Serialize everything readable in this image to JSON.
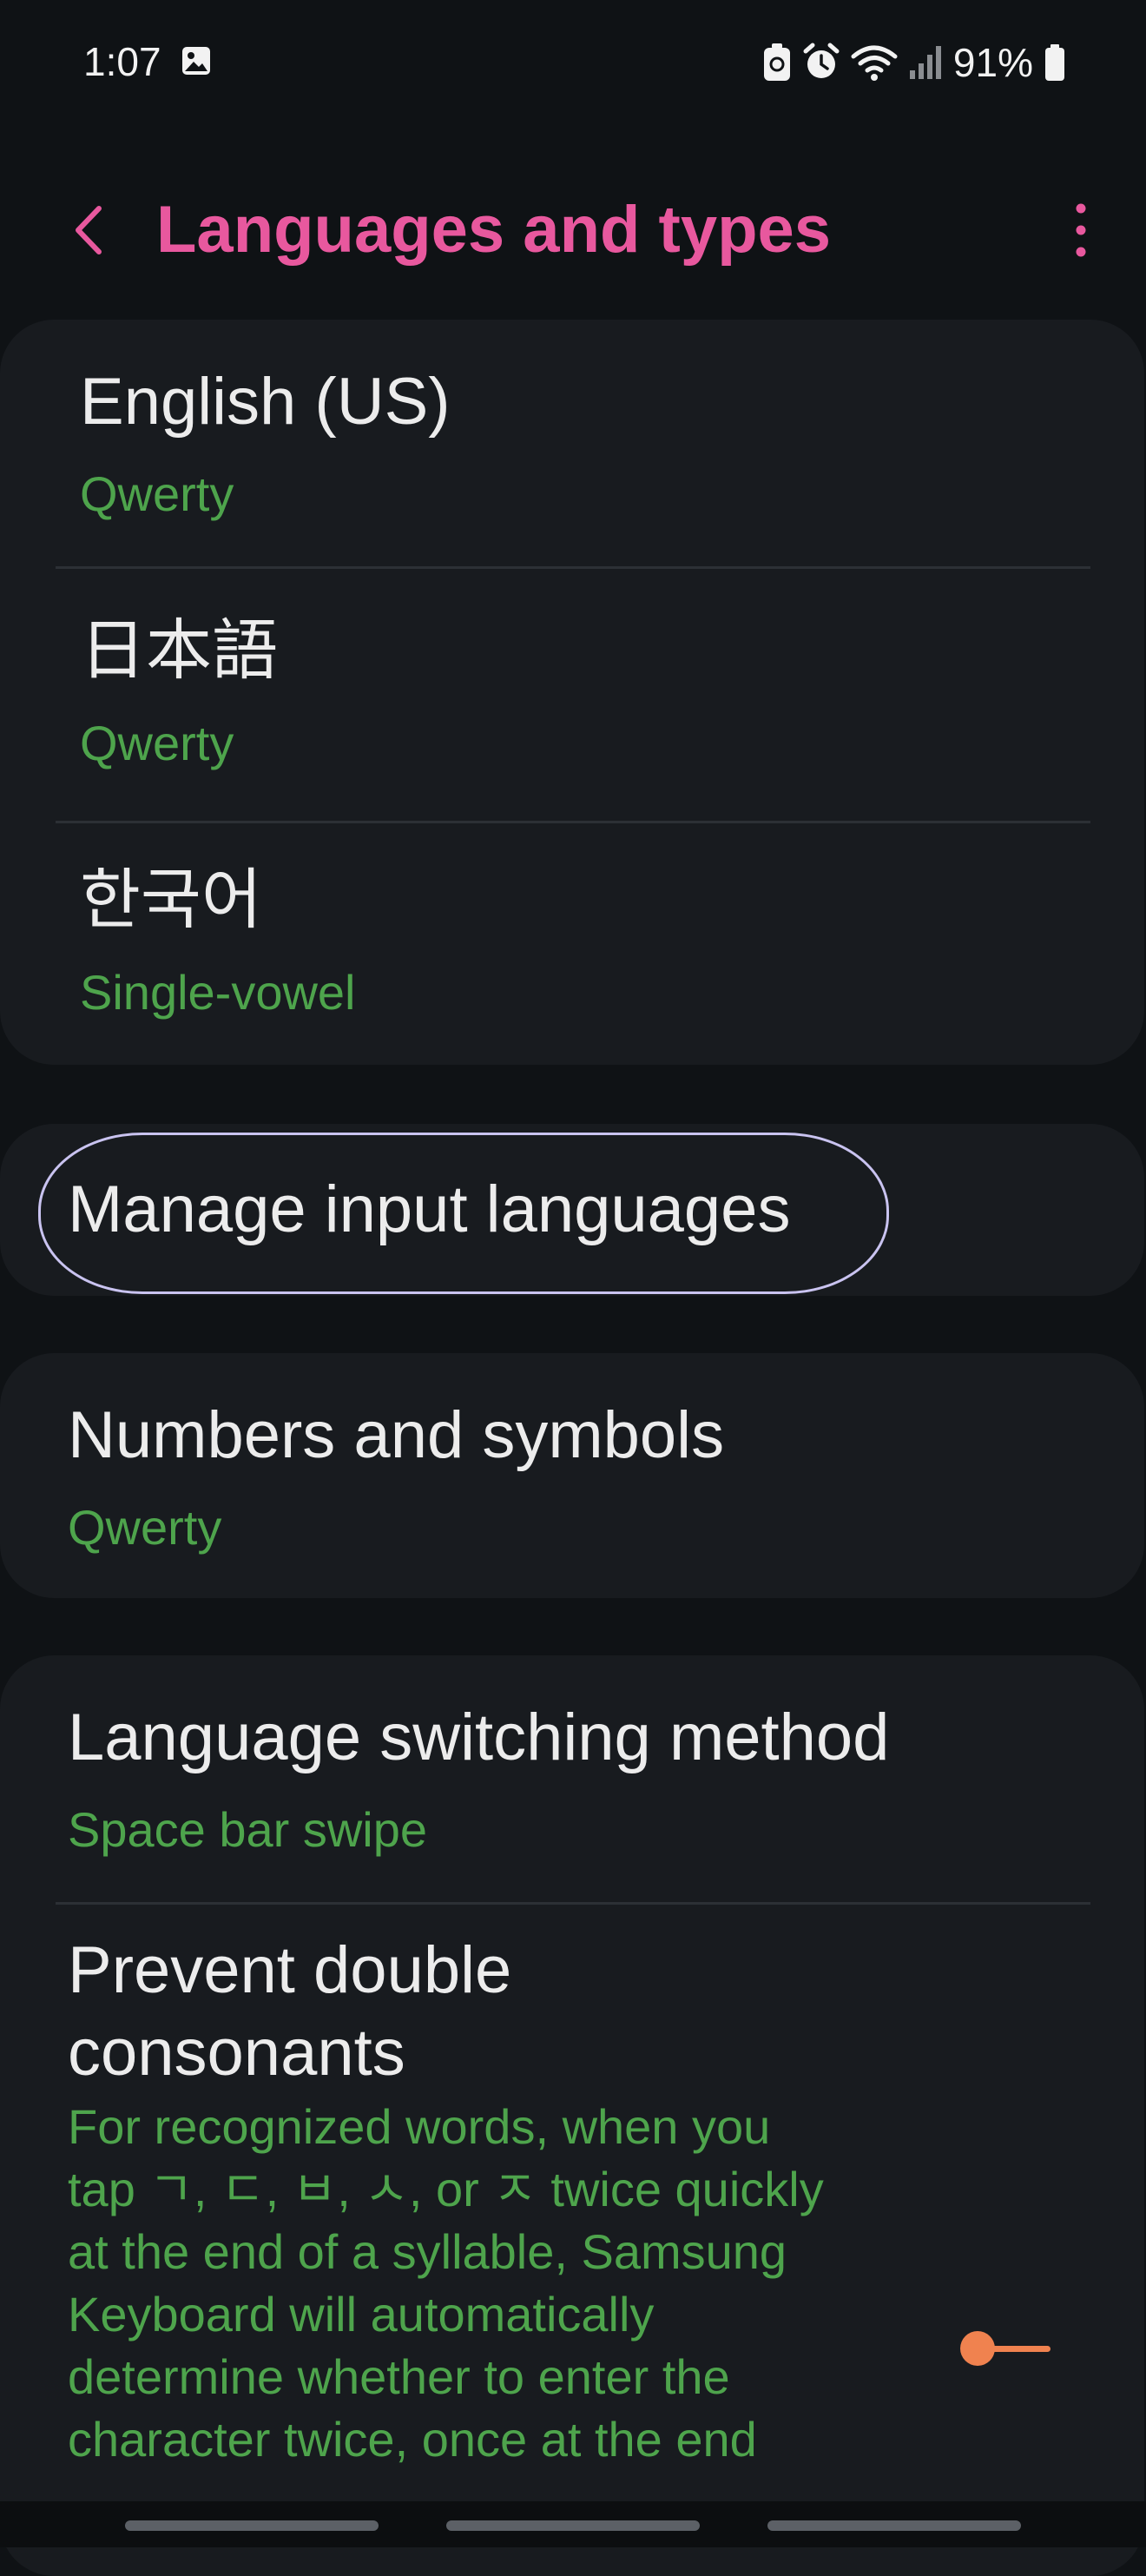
{
  "status_bar": {
    "time": "1:07",
    "battery": "91%",
    "icons": [
      "gallery-icon",
      "battery-saver-icon",
      "alarm-icon",
      "wifi-icon",
      "signal-icon",
      "battery-icon"
    ]
  },
  "header": {
    "title": "Languages and types",
    "back_icon": "chevron-left-icon",
    "more_icon": "more-vert-icon"
  },
  "colors": {
    "title_accent": "#e8589e",
    "subtitle_green": "#4ea44c",
    "background": "#0f1215",
    "card": "#181b1f",
    "toggle_accent": "#f0824f"
  },
  "languages": [
    {
      "name": "English (US)",
      "type": "Qwerty"
    },
    {
      "name": "日本語",
      "type": "Qwerty"
    },
    {
      "name": "한국어",
      "type": "Single-vowel"
    }
  ],
  "manage": {
    "label": "Manage input languages"
  },
  "numbers": {
    "title": "Numbers and symbols",
    "type": "Qwerty"
  },
  "switching": {
    "title": "Language switching method",
    "value": "Space bar swipe"
  },
  "prevent": {
    "title_line1": "Prevent double",
    "title_line2": "consonants",
    "desc_lines": [
      "For recognized words, when you",
      "tap ㄱ, ㄷ, ㅂ, ㅅ, or ㅈ twice quickly",
      "at the end of a syllable, Samsung",
      "Keyboard will automatically",
      "determine whether to enter the",
      "character twice, once at the end"
    ],
    "toggle_on": false
  }
}
